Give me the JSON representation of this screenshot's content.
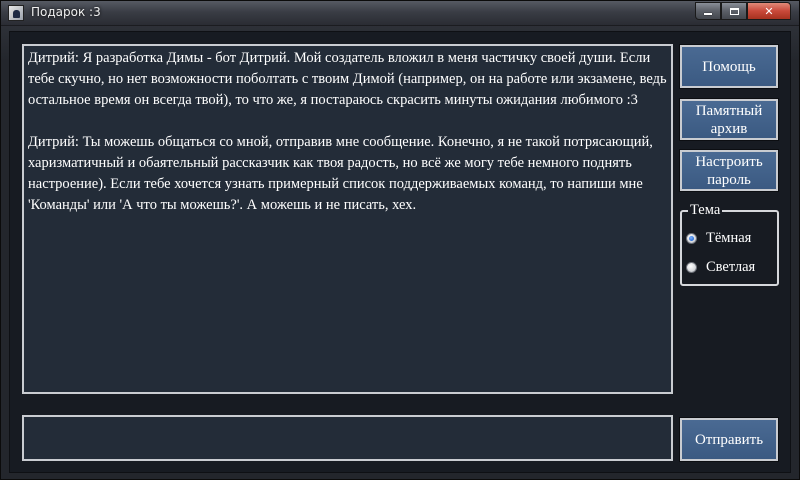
{
  "window": {
    "title": "Подарок :3",
    "minimize_icon": "minimize-icon",
    "maximize_icon": "maximize-icon",
    "close_symbol": "✕"
  },
  "chat": {
    "messages": [
      "Дитрий: Я разработка Димы - бот Дитрий. Мой создатель вложил в меня частичку своей души. Если тебе скучно, но нет возможности поболтать с твоим Димой (например, он на работе или экзамене, ведь остальное время он всегда твой), то что же, я постараюсь скрасить минуты ожидания любимого :3",
      "Дитрий: Ты можешь общаться со мной, отправив мне сообщение. Конечно, я не такой потрясающий, харизматичный и обаятельный рассказчик как твоя радость, но всё же могу тебе немного поднять настроение). Если тебе хочется узнать примерный список поддерживаемых команд, то напиши мне 'Команды' или 'А что ты можешь?'. А можешь и не писать, хех."
    ],
    "input_value": ""
  },
  "buttons": {
    "help": "Помощь",
    "archive": "Памятный архив",
    "password": "Настроить пароль",
    "send": "Отправить"
  },
  "theme": {
    "legend": "Тема",
    "options": [
      {
        "label": "Тёмная",
        "selected": true
      },
      {
        "label": "Светлая",
        "selected": false
      }
    ]
  },
  "colors": {
    "button_bg": "#3f5f88",
    "chat_bg": "#232c38",
    "client_bg": "#171b22",
    "close_button": "#c9493a"
  }
}
